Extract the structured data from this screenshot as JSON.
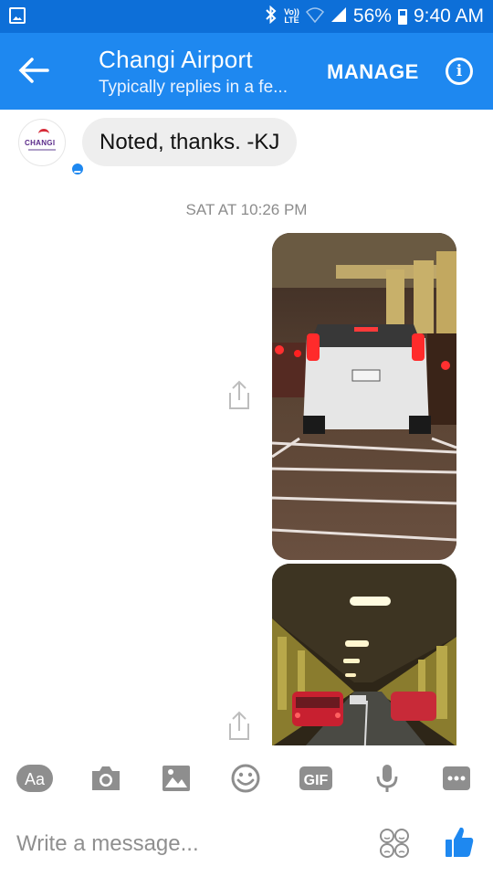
{
  "status_bar": {
    "battery": "56%",
    "time": "9:40 AM",
    "network_label": "LTE",
    "volte_label": "Vo))"
  },
  "header": {
    "title": "Changi Airport",
    "subtitle": "Typically replies in a fe...",
    "manage_label": "MANAGE"
  },
  "conversation": {
    "avatar_brand": "CHANGI",
    "incoming_message": "Noted, thanks. -KJ",
    "timestamp": "SAT AT 10:26 PM",
    "photos": [
      {
        "description_icon": "photo-car-tunnel"
      },
      {
        "description_icon": "photo-tunnel-traffic"
      }
    ]
  },
  "toolbar": {
    "aa_label": "Aa",
    "gif_label": "GIF",
    "icons": [
      "camera-icon",
      "gallery-icon",
      "emoji-icon",
      "microphone-icon",
      "more-icon"
    ]
  },
  "composer": {
    "placeholder": "Write a message..."
  },
  "colors": {
    "status_bar": "#0d6fd8",
    "app_bar": "#1e88f0",
    "accent": "#1e88f0",
    "bubble": "#eeeeee",
    "icon_grey": "#8e8e8e"
  }
}
